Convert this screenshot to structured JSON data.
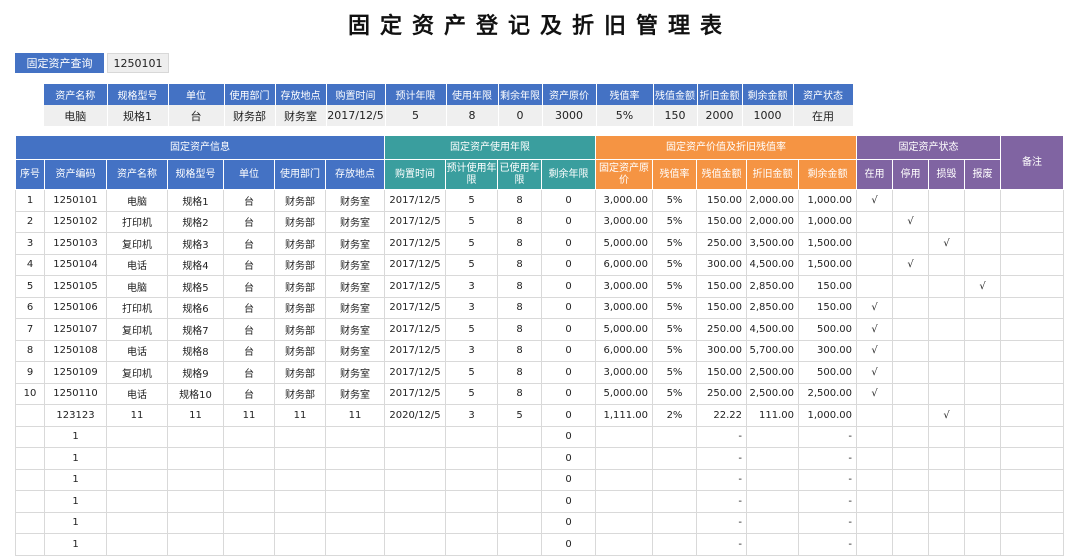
{
  "title": "固定资产登记及折旧管理表",
  "query": {
    "label": "固定资产查询",
    "value": "1250101"
  },
  "summary": {
    "headers": [
      "资产名称",
      "规格型号",
      "单位",
      "使用部门",
      "存放地点",
      "购置时间",
      "预计年限",
      "使用年限",
      "剩余年限",
      "资产原价",
      "残值率",
      "残值金额",
      "折旧金额",
      "剩余金额",
      "资产状态"
    ],
    "values": [
      "电脑",
      "规格1",
      "台",
      "财务部",
      "财务室",
      "2017/12/5",
      "5",
      "8",
      "0",
      "3000",
      "5%",
      "150",
      "2000",
      "1000",
      "在用"
    ]
  },
  "groups": {
    "info": "固定资产信息",
    "years": "固定资产使用年限",
    "value": "固定资产价值及折旧残值率",
    "status": "固定资产状态",
    "remark": "备注"
  },
  "columns": [
    "序号",
    "资产编码",
    "资产名称",
    "规格型号",
    "单位",
    "使用部门",
    "存放地点",
    "购置时间",
    "预计使用年限",
    "已使用年限",
    "剩余年限",
    "固定资产原价",
    "残值率",
    "残值金额",
    "折旧金额",
    "剩余金额",
    "在用",
    "停用",
    "损毁",
    "报废"
  ],
  "rows": [
    [
      "1",
      "1250101",
      "电脑",
      "规格1",
      "台",
      "财务部",
      "财务室",
      "2017/12/5",
      "5",
      "8",
      "0",
      "3,000.00",
      "5%",
      "150.00",
      "2,000.00",
      "1,000.00",
      "√",
      "",
      "",
      ""
    ],
    [
      "2",
      "1250102",
      "打印机",
      "规格2",
      "台",
      "财务部",
      "财务室",
      "2017/12/5",
      "5",
      "8",
      "0",
      "3,000.00",
      "5%",
      "150.00",
      "2,000.00",
      "1,000.00",
      "",
      "√",
      "",
      ""
    ],
    [
      "3",
      "1250103",
      "复印机",
      "规格3",
      "台",
      "财务部",
      "财务室",
      "2017/12/5",
      "5",
      "8",
      "0",
      "5,000.00",
      "5%",
      "250.00",
      "3,500.00",
      "1,500.00",
      "",
      "",
      "√",
      ""
    ],
    [
      "4",
      "1250104",
      "电话",
      "规格4",
      "台",
      "财务部",
      "财务室",
      "2017/12/5",
      "5",
      "8",
      "0",
      "6,000.00",
      "5%",
      "300.00",
      "4,500.00",
      "1,500.00",
      "",
      "√",
      "",
      ""
    ],
    [
      "5",
      "1250105",
      "电脑",
      "规格5",
      "台",
      "财务部",
      "财务室",
      "2017/12/5",
      "3",
      "8",
      "0",
      "3,000.00",
      "5%",
      "150.00",
      "2,850.00",
      "150.00",
      "",
      "",
      "",
      "√"
    ],
    [
      "6",
      "1250106",
      "打印机",
      "规格6",
      "台",
      "财务部",
      "财务室",
      "2017/12/5",
      "3",
      "8",
      "0",
      "3,000.00",
      "5%",
      "150.00",
      "2,850.00",
      "150.00",
      "√",
      "",
      "",
      ""
    ],
    [
      "7",
      "1250107",
      "复印机",
      "规格7",
      "台",
      "财务部",
      "财务室",
      "2017/12/5",
      "5",
      "8",
      "0",
      "5,000.00",
      "5%",
      "250.00",
      "4,500.00",
      "500.00",
      "√",
      "",
      "",
      ""
    ],
    [
      "8",
      "1250108",
      "电话",
      "规格8",
      "台",
      "财务部",
      "财务室",
      "2017/12/5",
      "3",
      "8",
      "0",
      "6,000.00",
      "5%",
      "300.00",
      "5,700.00",
      "300.00",
      "√",
      "",
      "",
      ""
    ],
    [
      "9",
      "1250109",
      "复印机",
      "规格9",
      "台",
      "财务部",
      "财务室",
      "2017/12/5",
      "5",
      "8",
      "0",
      "3,000.00",
      "5%",
      "150.00",
      "2,500.00",
      "500.00",
      "√",
      "",
      "",
      ""
    ],
    [
      "10",
      "1250110",
      "电话",
      "规格10",
      "台",
      "财务部",
      "财务室",
      "2017/12/5",
      "5",
      "8",
      "0",
      "5,000.00",
      "5%",
      "250.00",
      "2,500.00",
      "2,500.00",
      "√",
      "",
      "",
      ""
    ],
    [
      "",
      "123123",
      "11",
      "11",
      "11",
      "11",
      "11",
      "2020/12/5",
      "3",
      "5",
      "0",
      "1,111.00",
      "2%",
      "22.22",
      "111.00",
      "1,000.00",
      "",
      "",
      "√",
      ""
    ],
    [
      "",
      "1",
      "",
      "",
      "",
      "",
      "",
      "",
      "",
      "",
      "0",
      "",
      "",
      "-",
      "",
      "-",
      "",
      "",
      "",
      ""
    ],
    [
      "",
      "1",
      "",
      "",
      "",
      "",
      "",
      "",
      "",
      "",
      "0",
      "",
      "",
      "-",
      "",
      "-",
      "",
      "",
      "",
      ""
    ],
    [
      "",
      "1",
      "",
      "",
      "",
      "",
      "",
      "",
      "",
      "",
      "0",
      "",
      "",
      "-",
      "",
      "-",
      "",
      "",
      "",
      ""
    ],
    [
      "",
      "1",
      "",
      "",
      "",
      "",
      "",
      "",
      "",
      "",
      "0",
      "",
      "",
      "-",
      "",
      "-",
      "",
      "",
      "",
      ""
    ],
    [
      "",
      "1",
      "",
      "",
      "",
      "",
      "",
      "",
      "",
      "",
      "0",
      "",
      "",
      "-",
      "",
      "-",
      "",
      "",
      "",
      ""
    ],
    [
      "",
      "1",
      "",
      "",
      "",
      "",
      "",
      "",
      "",
      "",
      "0",
      "",
      "",
      "-",
      "",
      "-",
      "",
      "",
      "",
      ""
    ]
  ]
}
